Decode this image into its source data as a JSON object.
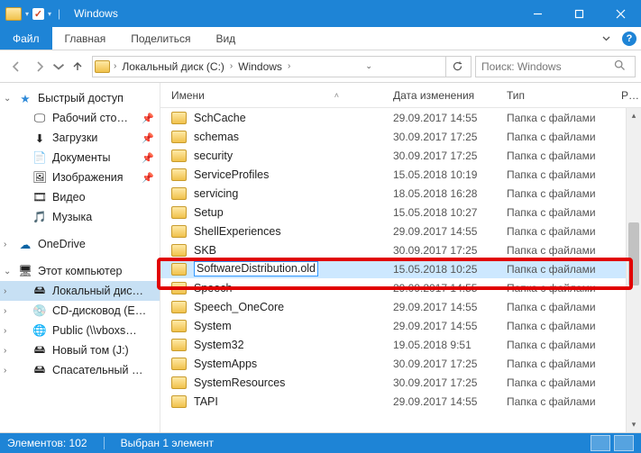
{
  "window": {
    "title": "Windows"
  },
  "tabs": {
    "file": "Файл",
    "home": "Главная",
    "share": "Поделиться",
    "view": "Вид"
  },
  "breadcrumb": {
    "disk": "Локальный диск (C:)",
    "folder": "Windows"
  },
  "search": {
    "placeholder": "Поиск: Windows"
  },
  "columns": {
    "name": "Имени",
    "date": "Дата изменения",
    "type": "Тип",
    "size": "Р…"
  },
  "sidebar": {
    "quick": "Быстрый доступ",
    "items": [
      {
        "label": "Рабочий сто…",
        "pin": true
      },
      {
        "label": "Загрузки",
        "pin": true
      },
      {
        "label": "Документы",
        "pin": true
      },
      {
        "label": "Изображения",
        "pin": true
      },
      {
        "label": "Видео",
        "pin": false
      },
      {
        "label": "Музыка",
        "pin": false
      }
    ],
    "onedrive": "OneDrive",
    "thispc": "Этот компьютер",
    "drives": [
      {
        "label": "Локальный дис…"
      },
      {
        "label": "CD-дисковод (E…"
      },
      {
        "label": "Public (\\\\vboxs…"
      },
      {
        "label": "Новый том (J:)"
      },
      {
        "label": "Спасательный …"
      }
    ]
  },
  "files": [
    {
      "name": "SchCache",
      "date": "29.09.2017 14:55",
      "type": "Папка с файлами"
    },
    {
      "name": "schemas",
      "date": "30.09.2017 17:25",
      "type": "Папка с файлами"
    },
    {
      "name": "security",
      "date": "30.09.2017 17:25",
      "type": "Папка с файлами"
    },
    {
      "name": "ServiceProfiles",
      "date": "15.05.2018 10:19",
      "type": "Папка с файлами"
    },
    {
      "name": "servicing",
      "date": "18.05.2018 16:28",
      "type": "Папка с файлами"
    },
    {
      "name": "Setup",
      "date": "15.05.2018 10:27",
      "type": "Папка с файлами"
    },
    {
      "name": "ShellExperiences",
      "date": "29.09.2017 14:55",
      "type": "Папка с файлами"
    },
    {
      "name": "SKB",
      "date": "30.09.2017 17:25",
      "type": "Папка с файлами"
    },
    {
      "name": "SoftwareDistribution.old",
      "date": "15.05.2018 10:25",
      "type": "Папка с файлами",
      "selected": true,
      "rename": true
    },
    {
      "name": "Speech",
      "date": "29.09.2017 14:55",
      "type": "Папка с файлами"
    },
    {
      "name": "Speech_OneCore",
      "date": "29.09.2017 14:55",
      "type": "Папка с файлами"
    },
    {
      "name": "System",
      "date": "29.09.2017 14:55",
      "type": "Папка с файлами"
    },
    {
      "name": "System32",
      "date": "19.05.2018 9:51",
      "type": "Папка с файлами"
    },
    {
      "name": "SystemApps",
      "date": "30.09.2017 17:25",
      "type": "Папка с файлами"
    },
    {
      "name": "SystemResources",
      "date": "30.09.2017 17:25",
      "type": "Папка с файлами"
    },
    {
      "name": "TAPI",
      "date": "29.09.2017 14:55",
      "type": "Папка с файлами"
    }
  ],
  "status": {
    "count_label": "Элементов:",
    "count": "102",
    "sel_label": "Выбран 1 элемент"
  }
}
